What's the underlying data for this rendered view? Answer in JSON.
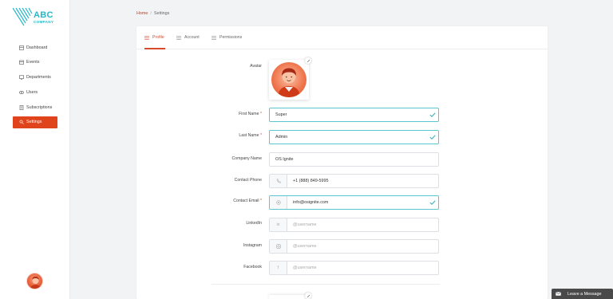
{
  "brand": {
    "name": "ABC",
    "sub": "COMPANY",
    "accent": "#27b8c8"
  },
  "sidebar": {
    "items": [
      {
        "label": "Dashboard",
        "icon": "dashboard-icon"
      },
      {
        "label": "Events",
        "icon": "calendar-icon"
      },
      {
        "label": "Departments",
        "icon": "monitor-icon"
      },
      {
        "label": "Users",
        "icon": "eye-icon"
      },
      {
        "label": "Subscriptions",
        "icon": "document-icon"
      },
      {
        "label": "Settings",
        "icon": "settings-icon",
        "active": true
      }
    ]
  },
  "breadcrumb": {
    "home": "Home",
    "separator": "/",
    "current": "Settings"
  },
  "tabs": [
    {
      "label": "Profile",
      "active": true
    },
    {
      "label": "Account"
    },
    {
      "label": "Permissions"
    }
  ],
  "form": {
    "avatar_label": "Avatar",
    "first_name": {
      "label": "First Name",
      "required": "*",
      "value": "Super"
    },
    "last_name": {
      "label": "Last Name",
      "required": "*",
      "value": "Admin"
    },
    "company": {
      "label": "Company Name",
      "value": "OS Ignite"
    },
    "phone": {
      "label": "Contact Phone",
      "value": "+1 (888) 849-5995",
      "icon": "phone-icon"
    },
    "email": {
      "label": "Contact Email",
      "required": "*",
      "value": "info@osignite.com",
      "icon": "at-icon"
    },
    "linkedin": {
      "label": "LinkedIn",
      "placeholder": "@username",
      "icon": "linkedin-icon",
      "prefix": "in"
    },
    "instagram": {
      "label": "Instagram",
      "placeholder": "@username",
      "icon": "instagram-icon"
    },
    "facebook": {
      "label": "Facebook",
      "placeholder": "@username",
      "icon": "facebook-icon",
      "prefix": "f"
    }
  },
  "chat": {
    "label": "Leave a Message"
  },
  "colors": {
    "primary": "#e0441c",
    "valid": "#5cc6cf",
    "tab_active": "#d94a2b"
  }
}
